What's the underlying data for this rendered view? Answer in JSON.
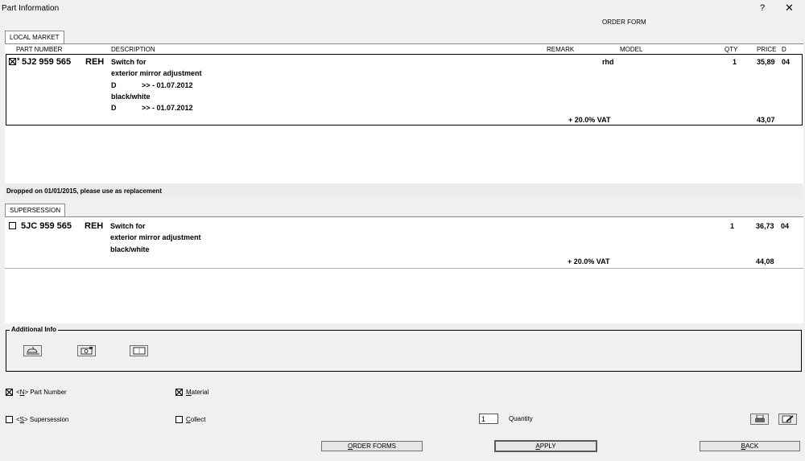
{
  "window": {
    "title": "Part Information",
    "help": "?",
    "close": "✕"
  },
  "order_form_label": "ORDER FORM",
  "tabs": {
    "local_market": "LOCAL MARKET",
    "supersession": "SUPERSESSION"
  },
  "columns": {
    "part_number": "PART NUMBER",
    "description": "DESCRIPTION",
    "remark": "REMARK",
    "model": "MODEL",
    "qty": "QTY",
    "price": "PRICE",
    "d": "D"
  },
  "local_item": {
    "marker": "*",
    "part_number": "5J2 959 565",
    "code": "REH",
    "desc1": "Switch for",
    "desc2": "exterior mirror adjustment",
    "d1_letter": "D",
    "d1_date": ">> - 01.07.2012",
    "desc3": "black/white",
    "d2_letter": "D",
    "d2_date": ">> - 01.07.2012",
    "model": "rhd",
    "qty": "1",
    "price": "35,89",
    "d": "04",
    "vat_label": "+ 20.0% VAT",
    "vat_price": "43,07"
  },
  "dropped_notice": "Dropped on 01/01/2015, please use as replacement",
  "super_item": {
    "part_number": "5JC 959 565",
    "code": "REH",
    "desc1": "Switch for",
    "desc2": "exterior mirror adjustment",
    "desc3": "black/white",
    "qty": "1",
    "price": "36,73",
    "d": "04",
    "vat_label": "+ 20.0% VAT",
    "vat_price": "44,08"
  },
  "additional_info": {
    "label": "Additional Info",
    "icons": [
      "car-lift-icon",
      "camera-icon",
      "book-icon"
    ]
  },
  "options": {
    "part_number": {
      "pre": "<",
      "key": "N",
      "post": "> Part Number",
      "checked": true
    },
    "material": {
      "key": "M",
      "rest": "aterial",
      "checked": true
    },
    "supersession": {
      "pre": "<",
      "key": "S",
      "post": "> Supersession",
      "checked": false
    },
    "collect": {
      "key": "C",
      "rest": "ollect",
      "checked": false
    }
  },
  "quantity": {
    "value": "1",
    "label": "Quantity"
  },
  "buttons": {
    "order_forms": {
      "key": "O",
      "rest": "RDER FORMS"
    },
    "apply": {
      "key": "A",
      "rest": "PPLY"
    },
    "back": {
      "key": "B",
      "rest": "ACK"
    }
  }
}
